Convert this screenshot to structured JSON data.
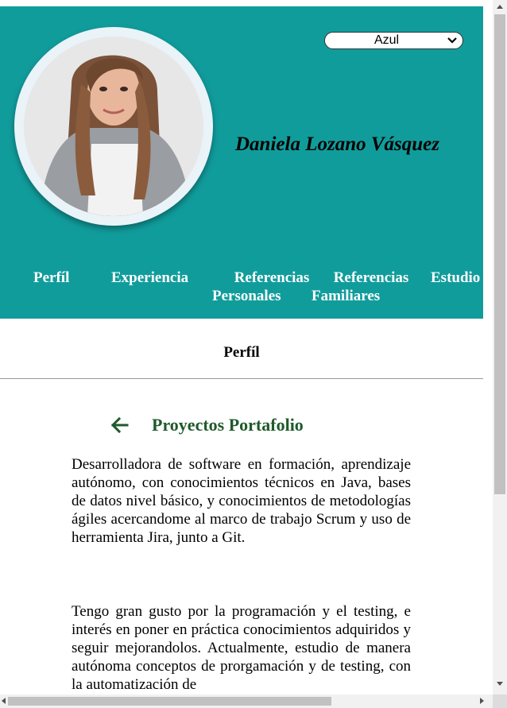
{
  "theme_select": {
    "value": "Azul"
  },
  "header": {
    "name": "Daniela Lozano Vásquez"
  },
  "nav": {
    "items": [
      {
        "line1": "Perfíl",
        "line2": ""
      },
      {
        "line1": "Experiencia",
        "line2": ""
      },
      {
        "line1": "Referencias",
        "line2": "Personales"
      },
      {
        "line1": "Referencias",
        "line2": "Familiares"
      },
      {
        "line1": "Estudio",
        "line2": ""
      }
    ]
  },
  "section": {
    "title": "Perfíl"
  },
  "content": {
    "title": "Proyectos Portafolio",
    "paragraph1": "Desarrolladora de software en formación, aprendizaje autónomo, con conocimientos técnicos en Java, bases de datos nivel básico, y conocimientos de metodologías ágiles acercandome al marco de trabajo Scrum y uso de herramienta Jira, junto a Git.",
    "paragraph2": "Tengo gran gusto por la programación y el testing, e interés en poner en práctica conocimientos adquiridos y seguir mejorandolos. Actualmente, estudio de manera autónoma conceptos de prorgamación y de testing, con la automatización de"
  },
  "colors": {
    "header_bg": "#119c9c",
    "nav_text": "#ffffff",
    "title_green": "#1f5a2b"
  }
}
